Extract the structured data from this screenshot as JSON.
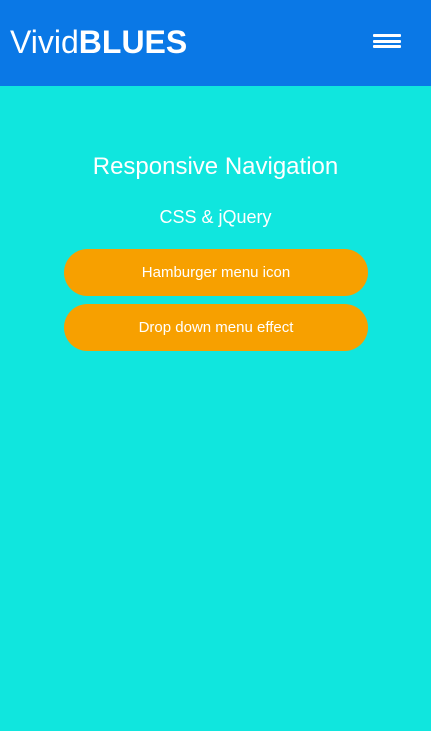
{
  "header": {
    "logo_light": "Vivid",
    "logo_bold": "BLUES",
    "menu_icon": "hamburger-menu-icon"
  },
  "main": {
    "title": "Responsive Navigation",
    "subtitle": "CSS & jQuery",
    "buttons": [
      {
        "label": "Hamburger menu icon"
      },
      {
        "label": "Drop down menu effect"
      }
    ]
  },
  "colors": {
    "header_bg": "#0a78e6",
    "page_bg": "#10e6de",
    "button_bg": "#f7a000",
    "text": "#ffffff"
  }
}
